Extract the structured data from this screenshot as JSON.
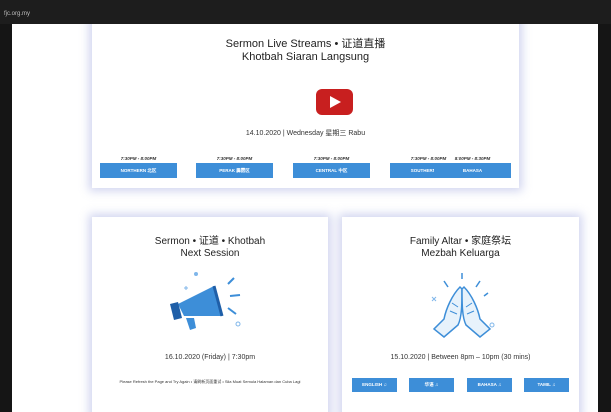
{
  "browser": {
    "url": "fjc.org.my"
  },
  "live": {
    "title_line1": "Sermon Live Streams • 证道直播",
    "title_line2": "Khotbah Siaran Langsung",
    "play_icon": "youtube-play-icon",
    "date": "14.10.2020 | Wednesday 星期三 Rabu",
    "sessions": [
      {
        "time": "7:30PM - 8:00PM",
        "label": "NORTHERN 北区"
      },
      {
        "time": "7:30PM - 8:00PM",
        "label": "PERAK 霹雳区"
      },
      {
        "time": "7:30PM - 8:00PM",
        "label": "CENTRAL 中区"
      },
      {
        "time": "7:30PM - 8:00PM",
        "label": "SOUTHERN 南区"
      },
      {
        "time": "8:00PM - 8:30PM",
        "label": "BAHASA"
      }
    ]
  },
  "sermon": {
    "title_line1": "Sermon • 证道 • Khotbah",
    "title_line2": "Next Session",
    "icon": "megaphone-icon",
    "date": "16.10.2020 (Friday) | 7:30pm",
    "note": "Please Refresh the Page and Try Again • 请刷新页面重试 • Sila Muat Semula Halaman dan Cuba Lagi"
  },
  "altar": {
    "title_line1": "Family Altar • 家庭祭坛",
    "title_line2": "Mezbah Keluarga",
    "icon": "praying-hands-icon",
    "date": "15.10.2020 | Between 8pm – 10pm (30 mins)",
    "languages": [
      {
        "label": "ENGLISH ♫"
      },
      {
        "label": "华语 ♫"
      },
      {
        "label": "BAHASA ♫"
      },
      {
        "label": "TAMIL ♫"
      }
    ]
  },
  "colors": {
    "button_blue": "#3d8ed8",
    "play_red": "#c81f1f",
    "card_glow": "#a0a8e0"
  }
}
